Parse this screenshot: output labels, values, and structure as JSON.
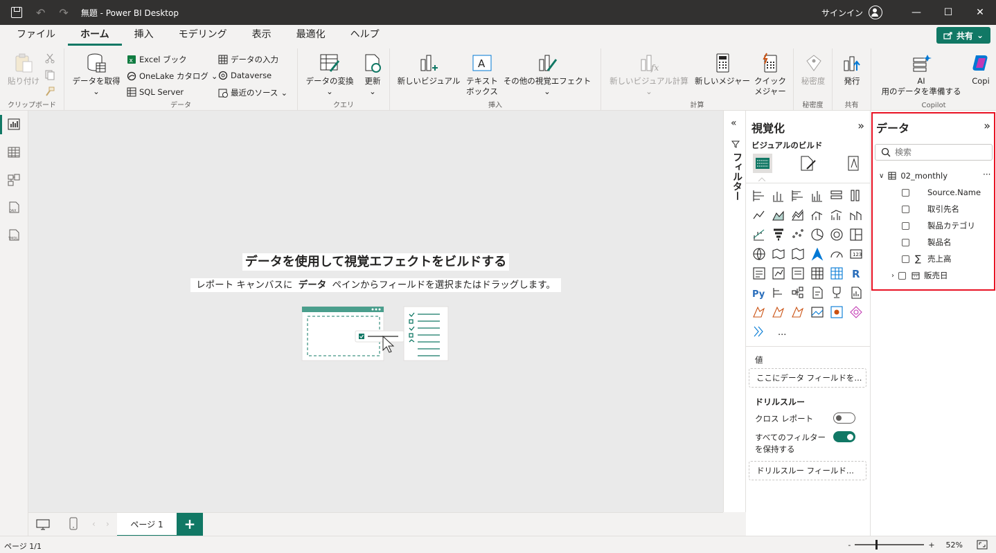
{
  "window": {
    "title": "無題 - Power BI Desktop",
    "signin": "サインイン",
    "minimize": "—",
    "maximize": "☐",
    "close": "✕"
  },
  "menu": {
    "tabs": [
      "ファイル",
      "ホーム",
      "挿入",
      "モデリング",
      "表示",
      "最適化",
      "ヘルプ"
    ],
    "active": "ホーム",
    "share_label": "共有"
  },
  "ribbon": {
    "clipboard": {
      "label": "クリップボード",
      "paste": "貼り付け"
    },
    "data": {
      "label": "データ",
      "get_data": "データを取得",
      "excel": "Excel ブック",
      "onelake": "OneLake カタログ",
      "sql": "SQL Server",
      "enter_data": "データの入力",
      "dataverse": "Dataverse",
      "recent": "最近のソース"
    },
    "query": {
      "label": "クエリ",
      "transform": "データの変換",
      "refresh": "更新"
    },
    "insert": {
      "label": "挿入",
      "new_visual": "新しいビジュアル",
      "textbox_1": "テキスト",
      "textbox_2": "ボックス",
      "more_visuals": "その他の視覚エフェクト"
    },
    "calc": {
      "label": "計算",
      "new_visual_calc": "新しいビジュアル計算",
      "new_measure": "新しいメジャー",
      "quick_1": "クイック",
      "quick_2": "メジャー"
    },
    "sensitivity": {
      "label": "秘密度",
      "btn": "秘密度"
    },
    "share": {
      "label": "共有",
      "publish": "発行"
    },
    "copilot": {
      "label": "Copilot",
      "ai_1": "AI",
      "ai_2": "用のデータを準備する",
      "copilot_btn": "Copi"
    }
  },
  "canvas": {
    "title": "データを使用して視覚エフェクトをビルドする",
    "sub_before": "レポート キャンバスに ",
    "sub_bold": "データ",
    "sub_after": " ペインからフィールドを選択またはドラッグします。"
  },
  "pages": {
    "tab": "ページ 1",
    "add": "+"
  },
  "status": {
    "page": "ページ 1/1",
    "zoom": "52%",
    "minus": "-",
    "plus": "+"
  },
  "filters": {
    "label": "フィルター"
  },
  "viz": {
    "title": "視覚化",
    "build": "ビジュアルのビルド",
    "values_label": "値",
    "values_placeholder": "ここにデータ フィールドを...",
    "drillthrough": "ドリルスルー",
    "cross_report": "クロス レポート",
    "cross_report_on": false,
    "keep_filters_1": "すべてのフィルター",
    "keep_filters_2": "を保持する",
    "keep_filters_on": true,
    "drill_placeholder": "ドリルスルー フィールド...",
    "more": "..."
  },
  "data": {
    "title": "データ",
    "search_placeholder": "検索",
    "table": "02_monthly",
    "fields": [
      {
        "name": "Source.Name",
        "type": "text"
      },
      {
        "name": "取引先名",
        "type": "text"
      },
      {
        "name": "製品カテゴリ",
        "type": "text"
      },
      {
        "name": "製品名",
        "type": "text"
      },
      {
        "name": "売上高",
        "type": "sum"
      },
      {
        "name": "販売日",
        "type": "date"
      }
    ]
  },
  "colors": {
    "accent": "#117865",
    "titlebar": "#323130",
    "highlight": "#e81123"
  }
}
